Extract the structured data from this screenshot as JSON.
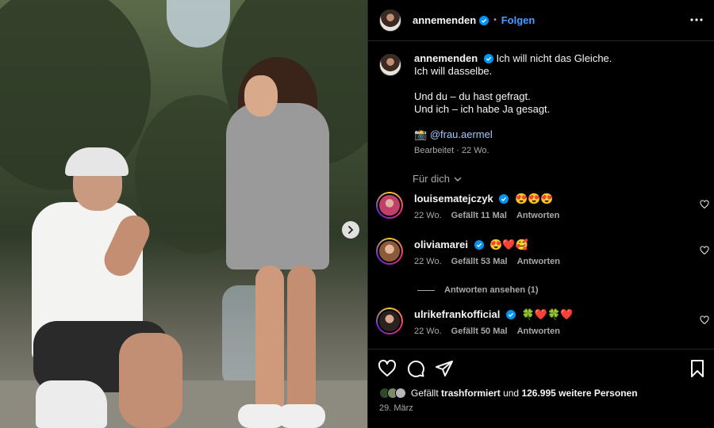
{
  "post": {
    "username": "annemenden",
    "follow_label": "Folgen",
    "dot": "•"
  },
  "caption": {
    "username": "annemenden",
    "line1": "Ich will nicht das Gleiche.",
    "line2": "Ich will dasselbe.",
    "line3": "Und du – du hast gefragt.",
    "line4": "Und ich – ich habe Ja gesagt.",
    "camera": "📸",
    "mention": "@frau.aermel",
    "meta": "Bearbeitet · 22 Wo."
  },
  "filter_label": "Für dich",
  "comments": [
    {
      "username": "louisematejczyk",
      "text": "😍😍😍",
      "age": "22 Wo.",
      "likes": "Gefällt 11 Mal",
      "reply": "Antworten"
    },
    {
      "username": "oliviamarei",
      "text": "😍❤️🥰",
      "age": "22 Wo.",
      "likes": "Gefällt 53 Mal",
      "reply": "Antworten"
    },
    {
      "username": "ulrikefrankofficial",
      "text": "🍀❤️🍀❤️",
      "age": "22 Wo.",
      "likes": "Gefällt 50 Mal",
      "reply": "Antworten"
    }
  ],
  "view_replies": "Antworten ansehen (1)",
  "likes": {
    "prefix": "Gefällt",
    "user": "trashformiert",
    "middle": "und",
    "count": "126.995 weitere Personen"
  },
  "date": "29. März",
  "colors": {
    "accent": "#4a9eff",
    "background": "#000000",
    "muted": "#a8a8a8"
  }
}
